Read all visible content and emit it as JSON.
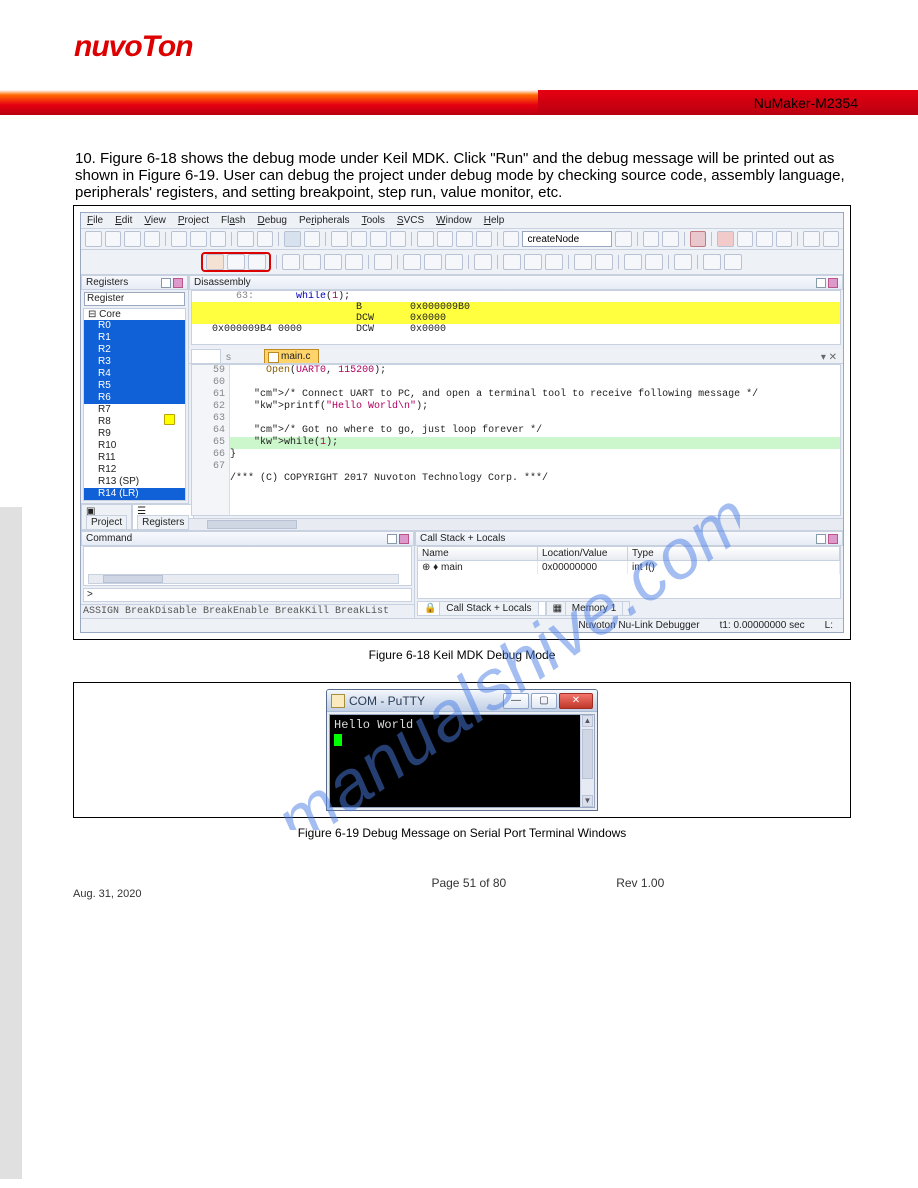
{
  "header": {
    "brand": "nuvoTon",
    "title_right": "NuMaker-M2354"
  },
  "section": {
    "run_line": "10. Figure 6-18 shows the debug mode under Keil MDK. Click \"Run\" and the debug message will be printed out as shown in Figure 6-19. User can debug the project under debug mode by checking source code, assembly language, peripherals' registers, and setting breakpoint, step run, value monitor, etc."
  },
  "fig18_caption": "Figure 6-18 Keil MDK Debug Mode",
  "fig19_caption": "Figure 6-19 Debug Message on Serial Port Terminal Windows",
  "ide": {
    "menubar": [
      "File",
      "Edit",
      "View",
      "Project",
      "Flash",
      "Debug",
      "Peripherals",
      "Tools",
      "SVCS",
      "Window",
      "Help"
    ],
    "searchbox": "createNode",
    "registers": {
      "panel": "Registers",
      "combo": "Register",
      "root": "Core",
      "sel_items": [
        "R0",
        "R1",
        "R2",
        "R3",
        "R4",
        "R5",
        "R6"
      ],
      "items": [
        "R7",
        "R8",
        "R9",
        "R10",
        "R11",
        "R12",
        "R13 (SP)"
      ],
      "last_sel": "R14 (LR)",
      "tabs": {
        "a": "Project",
        "b": "Registers"
      }
    },
    "disasm": {
      "panel": "Disassembly",
      "l1": "    63:       while(1);",
      "l2": "                        B        0x000009B0",
      "l3": "                        DCW      0x0000",
      "l4": "0x000009B4 0000         DCW      0x0000"
    },
    "filetab": "main.c",
    "code": {
      "lines": [
        {
          "n": "",
          "t": "      Open(UART0, 115200);"
        },
        {
          "n": "",
          "t": ""
        },
        {
          "n": "59",
          "t": "    /* Connect UART to PC, and open a terminal tool to receive following message */"
        },
        {
          "n": "60",
          "t": "    printf(\"Hello World\\n\");"
        },
        {
          "n": "61",
          "t": ""
        },
        {
          "n": "62",
          "t": "    /* Got no where to go, just loop forever */"
        },
        {
          "n": "63",
          "t": "    while(1);",
          "bp": true,
          "hl": true
        },
        {
          "n": "64",
          "t": "}"
        },
        {
          "n": "65",
          "t": ""
        },
        {
          "n": "66",
          "t": "/*** (C) COPYRIGHT 2017 Nuvoton Technology Corp. ***/"
        },
        {
          "n": "67",
          "t": ""
        }
      ]
    },
    "command": {
      "panel": "Command",
      "prompt": ">",
      "hints": "ASSIGN BreakDisable BreakEnable BreakKill BreakList"
    },
    "callstack": {
      "panel": "Call Stack + Locals",
      "headers": {
        "a": "Name",
        "b": "Location/Value",
        "c": "Type"
      },
      "row": {
        "a": "main",
        "b": "0x00000000",
        "c": "int f()"
      },
      "tabs": {
        "a": "Call Stack + Locals",
        "b": "Memory 1"
      }
    },
    "status": {
      "left": "Nuvoton Nu-Link Debugger",
      "right": "t1: 0.00000000 sec",
      "r2": "L:"
    }
  },
  "putty": {
    "title": "COM  - PuTTY",
    "output": "Hello World"
  },
  "watermark": "manualshive.com",
  "footer": {
    "date": "Aug. 31, 2020",
    "page": "Page 51 of 80",
    "rev": "Rev 1.00"
  }
}
